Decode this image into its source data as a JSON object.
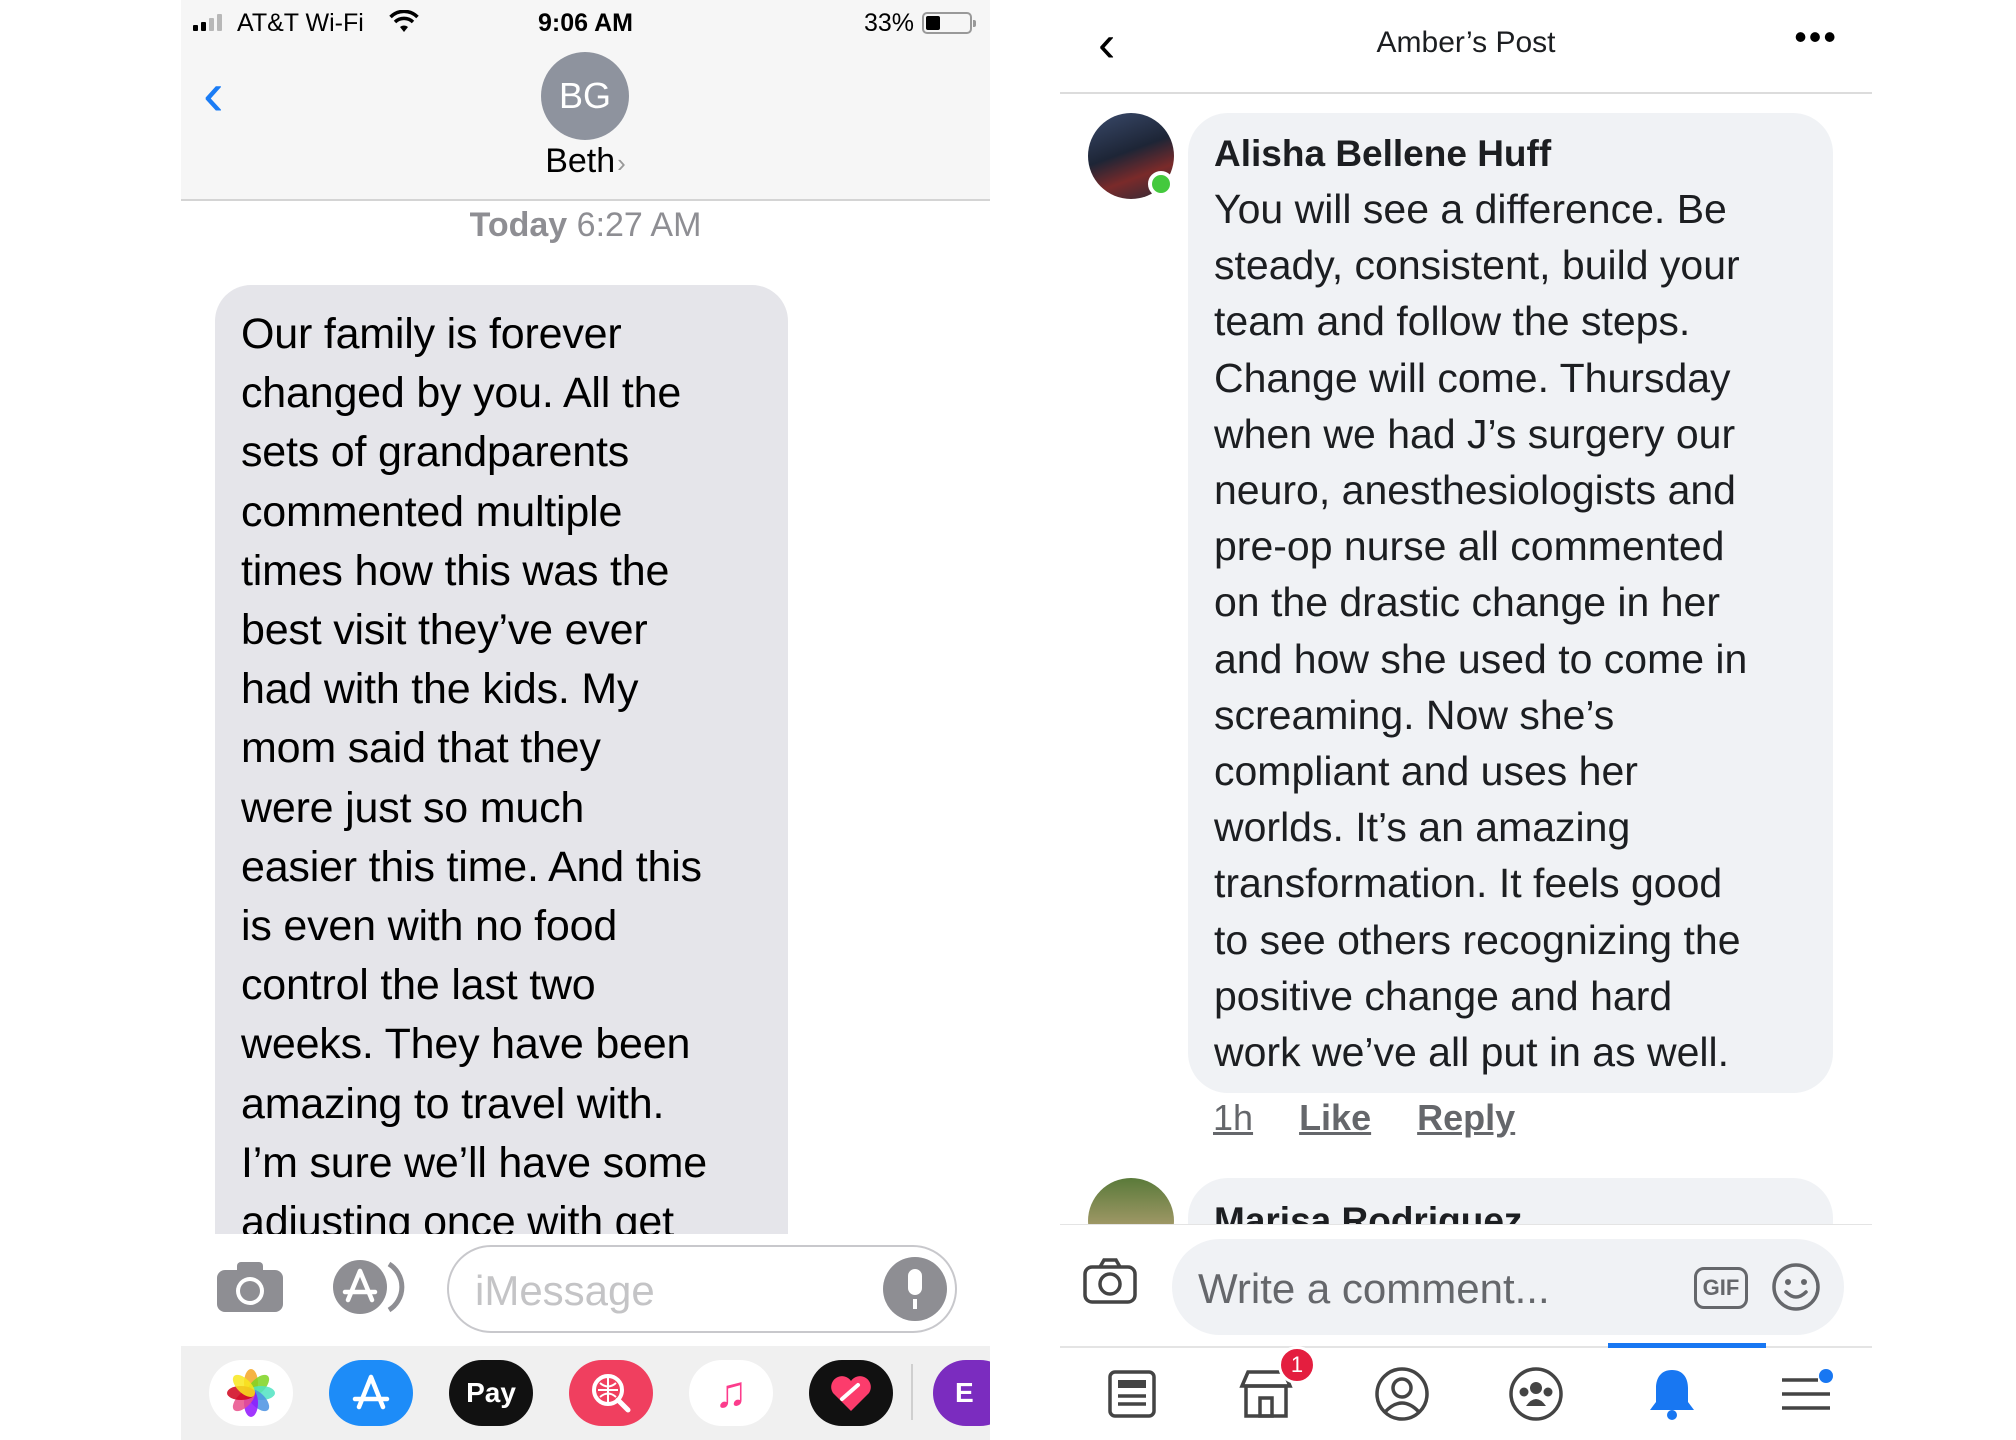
{
  "imessage": {
    "status": {
      "carrier": "AT&T Wi-Fi",
      "time": "9:06 AM",
      "battery": "33%",
      "battery_level": 0.33
    },
    "header": {
      "initials": "BG",
      "contact": "Beth",
      "contact_chevron": "›",
      "back_glyph": "‹"
    },
    "timestamp": {
      "day": "Today",
      "time": "6:27 AM"
    },
    "message_lines": [
      "Our family is forever",
      "changed by you. All the",
      "sets of grandparents",
      "commented multiple",
      "times how this was the",
      "best visit they’ve ever",
      "had with the kids. My",
      "mom said that they",
      "were just so much",
      "easier this time. And this",
      "is even with no food",
      "control the last two",
      "weeks. They have been",
      "amazing to travel with.",
      "I’m sure we’ll have some",
      "adjusting once with get"
    ],
    "compose": {
      "placeholder": "iMessage"
    },
    "tray": {
      "applepay_label": "Pay",
      "apple_glyph": "",
      "music_glyph": "♫",
      "partial_label": "E"
    },
    "icons": [
      "camera-icon",
      "app-store-icon",
      "microphone-icon",
      "photos-icon",
      "apple-pay-icon",
      "search-images-icon",
      "music-icon",
      "digital-touch-icon"
    ]
  },
  "facebook": {
    "header": {
      "title": "Amber’s Post",
      "back_glyph": "‹",
      "more_glyph": "•••"
    },
    "comment": {
      "author": "Alisha Bellene Huff",
      "text_lines": [
        "You will see a difference. Be",
        "steady, consistent, build your",
        "team and follow the steps.",
        "Change will come. Thursday",
        "when we had J’s surgery our",
        "neuro, anesthesiologists and",
        "pre-op nurse all commented",
        "on the drastic change in her",
        "and how she used to come in",
        "screaming. Now she’s",
        "compliant and uses her",
        "worlds. It’s an amazing",
        "transformation. It feels good",
        "to see others recognizing the",
        "positive change and hard",
        "work we’ve all put in as well."
      ],
      "age": "1h",
      "like": "Like",
      "reply": "Reply"
    },
    "next_comment": {
      "author": "Marisa Rodriguez"
    },
    "compose": {
      "placeholder": "Write a comment...",
      "gif": "GIF"
    },
    "nav": {
      "marketplace_badge": "1",
      "active_tab": "notifications"
    },
    "colors": {
      "accent": "#1877f2",
      "badge": "#e41e3f",
      "online": "#44c93d"
    }
  }
}
